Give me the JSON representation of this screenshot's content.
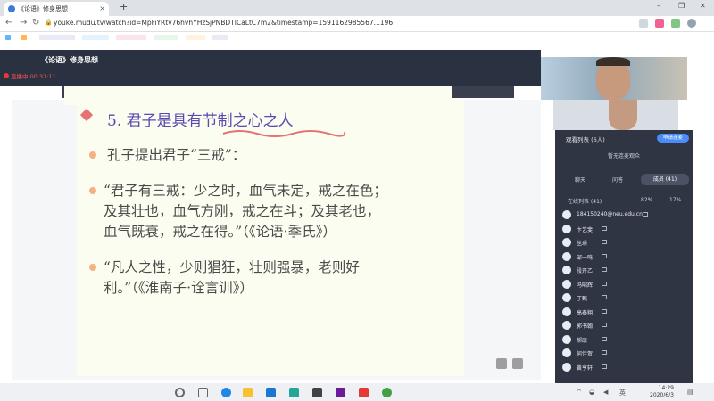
{
  "browser": {
    "tab_title": "《论语》修身思想",
    "close_glyph": "×",
    "new_tab_glyph": "+",
    "url": "youke.mudu.tv/watch?id=MpFiYRtv76hvhYHzSjPNBDTICaLtC7m2&timestamp=1591162985567.1196",
    "win_minimize": "–",
    "win_maximize": "❐",
    "win_close": "✕"
  },
  "course": {
    "title": "《论语》修身思想",
    "live_label": "直播中 00:31:11"
  },
  "slide": {
    "heading": "5. 君子是具有节制之心之人",
    "lines": [
      "孔子提出君子“三戒”：",
      "“君子有三戒：少之时，血气未定，戒之在色；",
      "及其壮也，血气方刚，戒之在斗；及其老也，",
      "血气既衰，戒之在得。”（《论语·季氏》）",
      "“凡人之性，少则猖狂，壮则强暴，老则好",
      "利。”（《淮南子·诠言训》）"
    ],
    "accent_color": "#5b48b0",
    "bullet_color": "#f4b183",
    "underline_color": "#e57373"
  },
  "panel": {
    "title": "观看列表 (6人)",
    "action_button": "申请连麦",
    "notice": "暂无连麦观众",
    "tabs": [
      "聊天",
      "问答",
      "成员 (41)"
    ],
    "online_label": "在线列表 (41)",
    "stat_mic": "82%",
    "stat_cam": "17%",
    "members": [
      "184150240@neu.edu.cn",
      "卞艺斐",
      "丛璟",
      "邸一鸣",
      "段开乙",
      "冯昭辉",
      "丁甄",
      "高泰翔",
      "郭书翰",
      "郝康",
      "何佳贺",
      "黄亨轩"
    ]
  },
  "taskbar": {
    "time": "14:29",
    "date": "2020/6/3"
  }
}
